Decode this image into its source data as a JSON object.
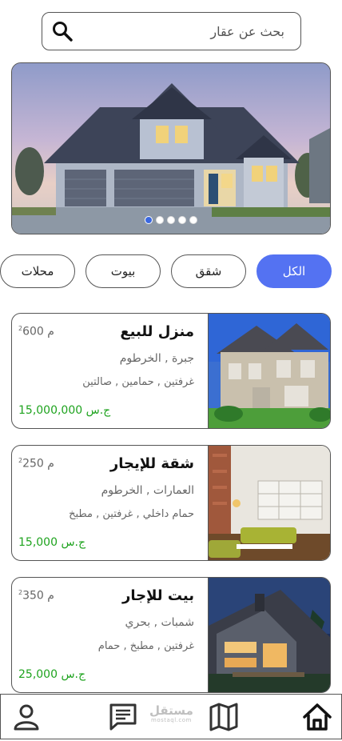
{
  "search": {
    "placeholder": "بحث عن عقار",
    "icon": "search-icon"
  },
  "hero": {
    "slides_count": 5,
    "active_slide": 1
  },
  "filters": [
    {
      "label": "الكل",
      "active": true
    },
    {
      "label": "شقق",
      "active": false
    },
    {
      "label": "بيوت",
      "active": false
    },
    {
      "label": "محلات",
      "active": false
    }
  ],
  "listings": [
    {
      "title": "منزل للبيع",
      "area": "600 م",
      "area_sup": "2",
      "location": "جبرة , الخرطوم",
      "features": "غرفتين , حمامين , صالتين",
      "price": "15,000,000 ج.س"
    },
    {
      "title": "شقة للإيجار",
      "area": "250 م",
      "area_sup": "2",
      "location": "العمارات , الخرطوم",
      "features": "حمام داخلي , غرفتين , مطبخ",
      "price": "15,000 ج.س"
    },
    {
      "title": "بيت للإجار",
      "area": "350 م",
      "area_sup": "2",
      "location": "شمبات , بحري",
      "features": "غرفتين , مطبخ , حمام",
      "price": "25,000 ج.س"
    }
  ],
  "nav": {
    "items": [
      "profile-icon",
      "chat-icon",
      "map-icon",
      "home-icon"
    ]
  },
  "watermark": {
    "arabic": "مستقل",
    "latin": "mostaql.com"
  },
  "colors": {
    "accent": "#5472f2",
    "price": "#1ea31e",
    "dot_active": "#3b68e0"
  }
}
